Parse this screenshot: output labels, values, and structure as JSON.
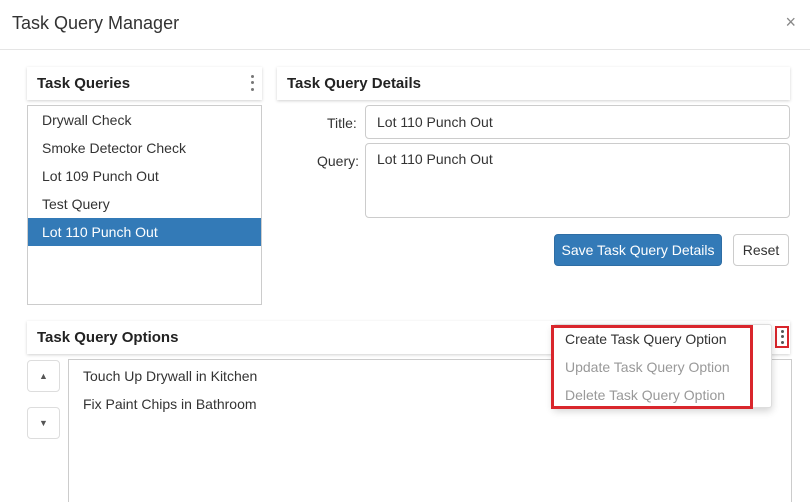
{
  "modal": {
    "title": "Task Query Manager",
    "close_glyph": "×"
  },
  "queries": {
    "header": "Task Queries",
    "items": [
      "Drywall Check",
      "Smoke Detector Check",
      "Lot 109 Punch Out",
      "Test Query",
      "Lot 110 Punch Out"
    ],
    "selected_index": 4
  },
  "details": {
    "header": "Task Query Details",
    "title_label": "Title:",
    "title_value": "Lot 110 Punch Out",
    "query_label": "Query:",
    "query_value": "Lot 110 Punch Out",
    "save_label": "Save Task Query Details",
    "reset_label": "Reset"
  },
  "options": {
    "header": "Task Query Options",
    "up_glyph": "▲",
    "down_glyph": "▼",
    "items": [
      "Touch Up Drywall in Kitchen",
      "Fix Paint Chips in Bathroom"
    ]
  },
  "menu": {
    "create_label": "Create Task Query Option",
    "update_label": "Update Task Query Option",
    "delete_label": "Delete Task Query Option"
  },
  "colors": {
    "primary": "#337ab7",
    "highlight": "#d9262c"
  }
}
